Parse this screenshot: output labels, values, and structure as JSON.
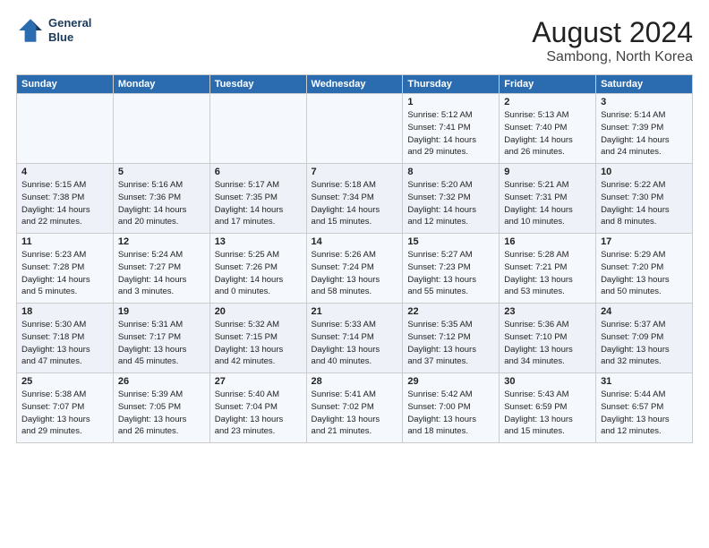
{
  "header": {
    "logo_line1": "General",
    "logo_line2": "Blue",
    "main_title": "August 2024",
    "subtitle": "Sambong, North Korea"
  },
  "days_of_week": [
    "Sunday",
    "Monday",
    "Tuesday",
    "Wednesday",
    "Thursday",
    "Friday",
    "Saturday"
  ],
  "weeks": [
    [
      {
        "day": "",
        "info": ""
      },
      {
        "day": "",
        "info": ""
      },
      {
        "day": "",
        "info": ""
      },
      {
        "day": "",
        "info": ""
      },
      {
        "day": "1",
        "info": "Sunrise: 5:12 AM\nSunset: 7:41 PM\nDaylight: 14 hours\nand 29 minutes."
      },
      {
        "day": "2",
        "info": "Sunrise: 5:13 AM\nSunset: 7:40 PM\nDaylight: 14 hours\nand 26 minutes."
      },
      {
        "day": "3",
        "info": "Sunrise: 5:14 AM\nSunset: 7:39 PM\nDaylight: 14 hours\nand 24 minutes."
      }
    ],
    [
      {
        "day": "4",
        "info": "Sunrise: 5:15 AM\nSunset: 7:38 PM\nDaylight: 14 hours\nand 22 minutes."
      },
      {
        "day": "5",
        "info": "Sunrise: 5:16 AM\nSunset: 7:36 PM\nDaylight: 14 hours\nand 20 minutes."
      },
      {
        "day": "6",
        "info": "Sunrise: 5:17 AM\nSunset: 7:35 PM\nDaylight: 14 hours\nand 17 minutes."
      },
      {
        "day": "7",
        "info": "Sunrise: 5:18 AM\nSunset: 7:34 PM\nDaylight: 14 hours\nand 15 minutes."
      },
      {
        "day": "8",
        "info": "Sunrise: 5:20 AM\nSunset: 7:32 PM\nDaylight: 14 hours\nand 12 minutes."
      },
      {
        "day": "9",
        "info": "Sunrise: 5:21 AM\nSunset: 7:31 PM\nDaylight: 14 hours\nand 10 minutes."
      },
      {
        "day": "10",
        "info": "Sunrise: 5:22 AM\nSunset: 7:30 PM\nDaylight: 14 hours\nand 8 minutes."
      }
    ],
    [
      {
        "day": "11",
        "info": "Sunrise: 5:23 AM\nSunset: 7:28 PM\nDaylight: 14 hours\nand 5 minutes."
      },
      {
        "day": "12",
        "info": "Sunrise: 5:24 AM\nSunset: 7:27 PM\nDaylight: 14 hours\nand 3 minutes."
      },
      {
        "day": "13",
        "info": "Sunrise: 5:25 AM\nSunset: 7:26 PM\nDaylight: 14 hours\nand 0 minutes."
      },
      {
        "day": "14",
        "info": "Sunrise: 5:26 AM\nSunset: 7:24 PM\nDaylight: 13 hours\nand 58 minutes."
      },
      {
        "day": "15",
        "info": "Sunrise: 5:27 AM\nSunset: 7:23 PM\nDaylight: 13 hours\nand 55 minutes."
      },
      {
        "day": "16",
        "info": "Sunrise: 5:28 AM\nSunset: 7:21 PM\nDaylight: 13 hours\nand 53 minutes."
      },
      {
        "day": "17",
        "info": "Sunrise: 5:29 AM\nSunset: 7:20 PM\nDaylight: 13 hours\nand 50 minutes."
      }
    ],
    [
      {
        "day": "18",
        "info": "Sunrise: 5:30 AM\nSunset: 7:18 PM\nDaylight: 13 hours\nand 47 minutes."
      },
      {
        "day": "19",
        "info": "Sunrise: 5:31 AM\nSunset: 7:17 PM\nDaylight: 13 hours\nand 45 minutes."
      },
      {
        "day": "20",
        "info": "Sunrise: 5:32 AM\nSunset: 7:15 PM\nDaylight: 13 hours\nand 42 minutes."
      },
      {
        "day": "21",
        "info": "Sunrise: 5:33 AM\nSunset: 7:14 PM\nDaylight: 13 hours\nand 40 minutes."
      },
      {
        "day": "22",
        "info": "Sunrise: 5:35 AM\nSunset: 7:12 PM\nDaylight: 13 hours\nand 37 minutes."
      },
      {
        "day": "23",
        "info": "Sunrise: 5:36 AM\nSunset: 7:10 PM\nDaylight: 13 hours\nand 34 minutes."
      },
      {
        "day": "24",
        "info": "Sunrise: 5:37 AM\nSunset: 7:09 PM\nDaylight: 13 hours\nand 32 minutes."
      }
    ],
    [
      {
        "day": "25",
        "info": "Sunrise: 5:38 AM\nSunset: 7:07 PM\nDaylight: 13 hours\nand 29 minutes."
      },
      {
        "day": "26",
        "info": "Sunrise: 5:39 AM\nSunset: 7:05 PM\nDaylight: 13 hours\nand 26 minutes."
      },
      {
        "day": "27",
        "info": "Sunrise: 5:40 AM\nSunset: 7:04 PM\nDaylight: 13 hours\nand 23 minutes."
      },
      {
        "day": "28",
        "info": "Sunrise: 5:41 AM\nSunset: 7:02 PM\nDaylight: 13 hours\nand 21 minutes."
      },
      {
        "day": "29",
        "info": "Sunrise: 5:42 AM\nSunset: 7:00 PM\nDaylight: 13 hours\nand 18 minutes."
      },
      {
        "day": "30",
        "info": "Sunrise: 5:43 AM\nSunset: 6:59 PM\nDaylight: 13 hours\nand 15 minutes."
      },
      {
        "day": "31",
        "info": "Sunrise: 5:44 AM\nSunset: 6:57 PM\nDaylight: 13 hours\nand 12 minutes."
      }
    ]
  ]
}
